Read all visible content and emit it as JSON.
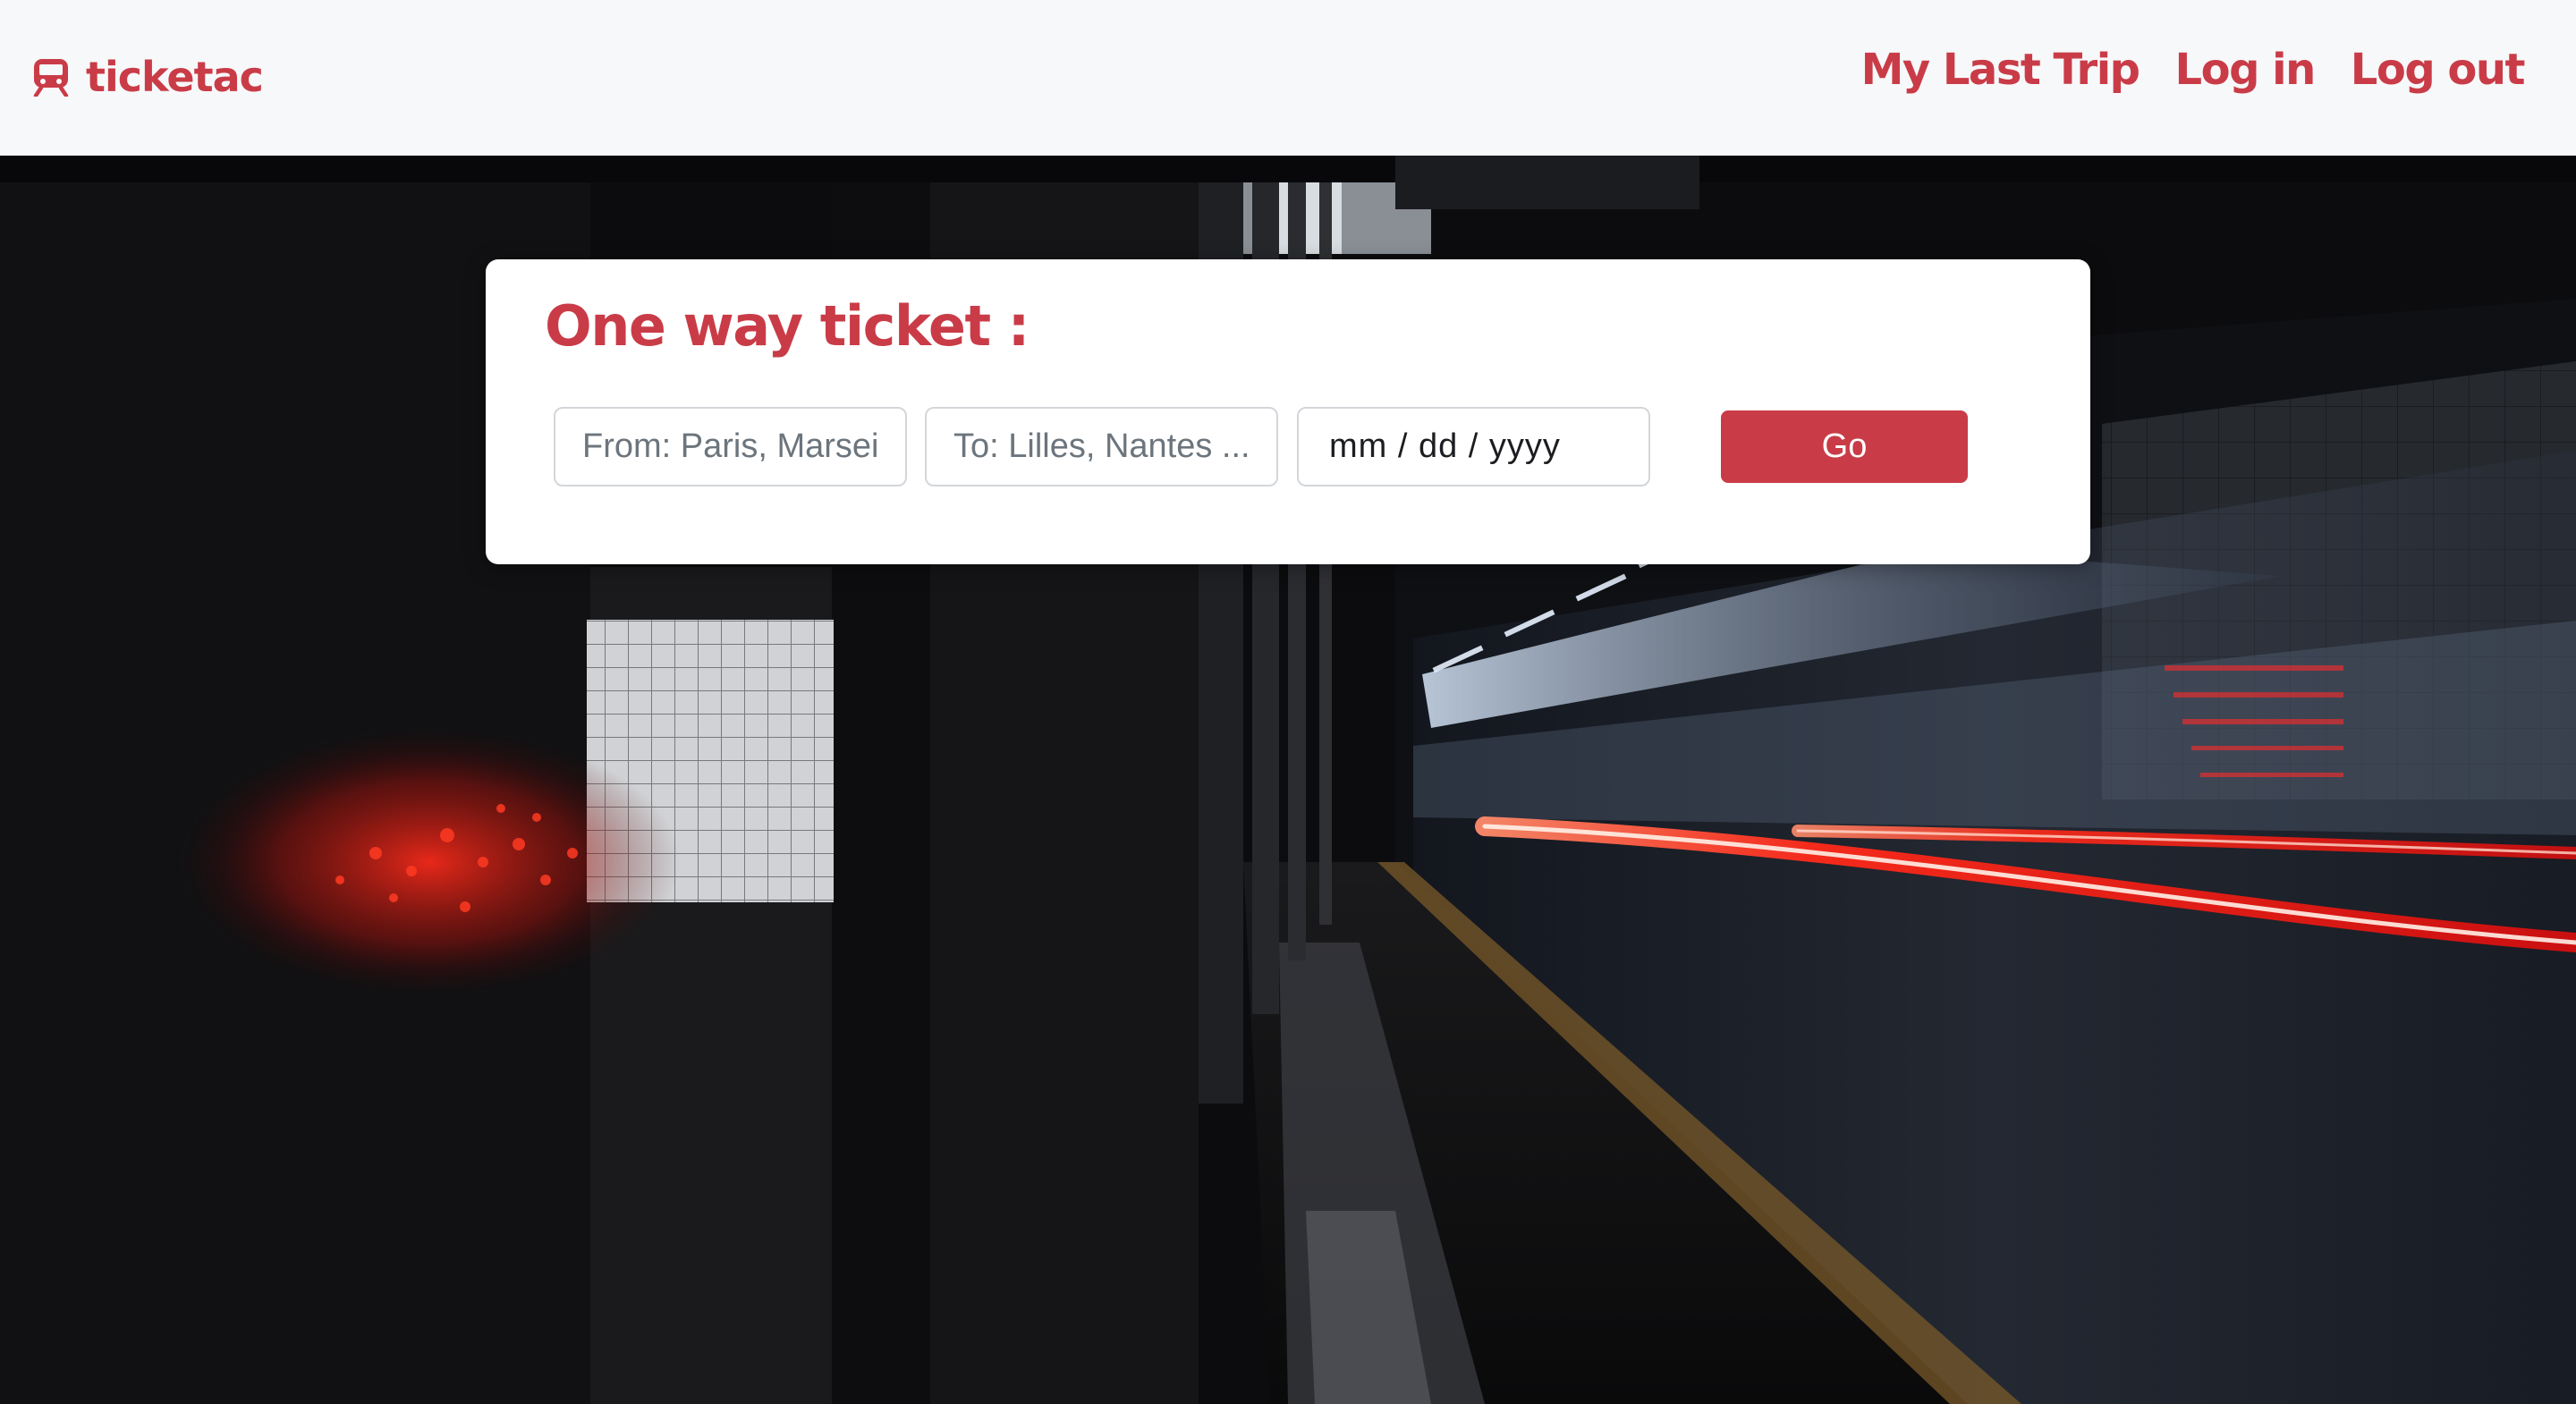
{
  "app": {
    "brand_name": "ticketac",
    "brand_icon": "train-icon",
    "accent_color": "#c93c47"
  },
  "nav": {
    "links": [
      {
        "label": "My Last Trip"
      },
      {
        "label": "Log in"
      },
      {
        "label": "Log out"
      }
    ]
  },
  "booking": {
    "title": "One way ticket :",
    "from_placeholder": "From: Paris, Marseille",
    "to_placeholder": "To: Lilles, Nantes ...",
    "date_placeholder": "mm / dd / yyyy",
    "go_label": "Go"
  },
  "hero": {
    "image_subject": "subway-platform-with-moving-train"
  }
}
